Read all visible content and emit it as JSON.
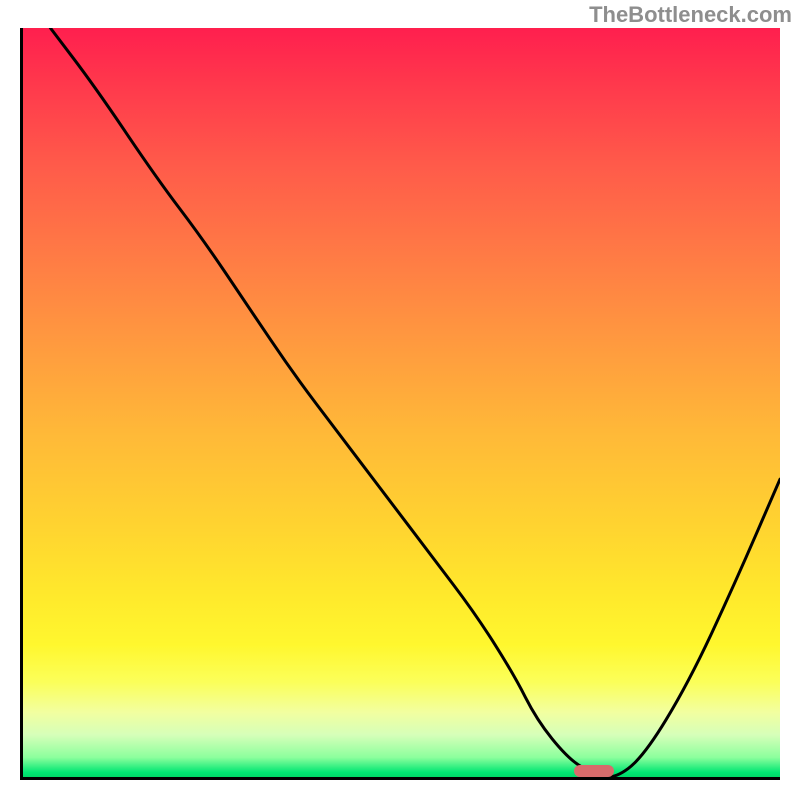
{
  "watermark": {
    "text": "TheBottleneck.com"
  },
  "chart_data": {
    "type": "line",
    "title": "",
    "xlabel": "",
    "ylabel": "",
    "xlim": [
      0,
      100
    ],
    "ylim": [
      0,
      100
    ],
    "grid": false,
    "legend": false,
    "background_gradient": {
      "direction": "vertical",
      "stops": [
        {
          "pos": 0.0,
          "color": "#ff1f4e"
        },
        {
          "pos": 0.3,
          "color": "#ff7a45"
        },
        {
          "pos": 0.66,
          "color": "#ffd330"
        },
        {
          "pos": 0.87,
          "color": "#fbff5a"
        },
        {
          "pos": 0.97,
          "color": "#8cff9d"
        },
        {
          "pos": 1.0,
          "color": "#00d060"
        }
      ]
    },
    "series": [
      {
        "name": "bottleneck-curve",
        "color": "#000000",
        "x": [
          4,
          10,
          18,
          24,
          30,
          36,
          42,
          48,
          54,
          60,
          65,
          68,
          72,
          75,
          78,
          82,
          88,
          94,
          100
        ],
        "y": [
          100,
          92,
          80,
          72,
          63,
          54,
          46,
          38,
          30,
          22,
          14,
          8,
          3,
          1,
          0,
          3,
          13,
          26,
          40
        ]
      }
    ],
    "marker": {
      "x_center": 75.5,
      "y": 1.2,
      "width": 5.3,
      "height": 1.7,
      "color": "#d86b6b"
    }
  }
}
